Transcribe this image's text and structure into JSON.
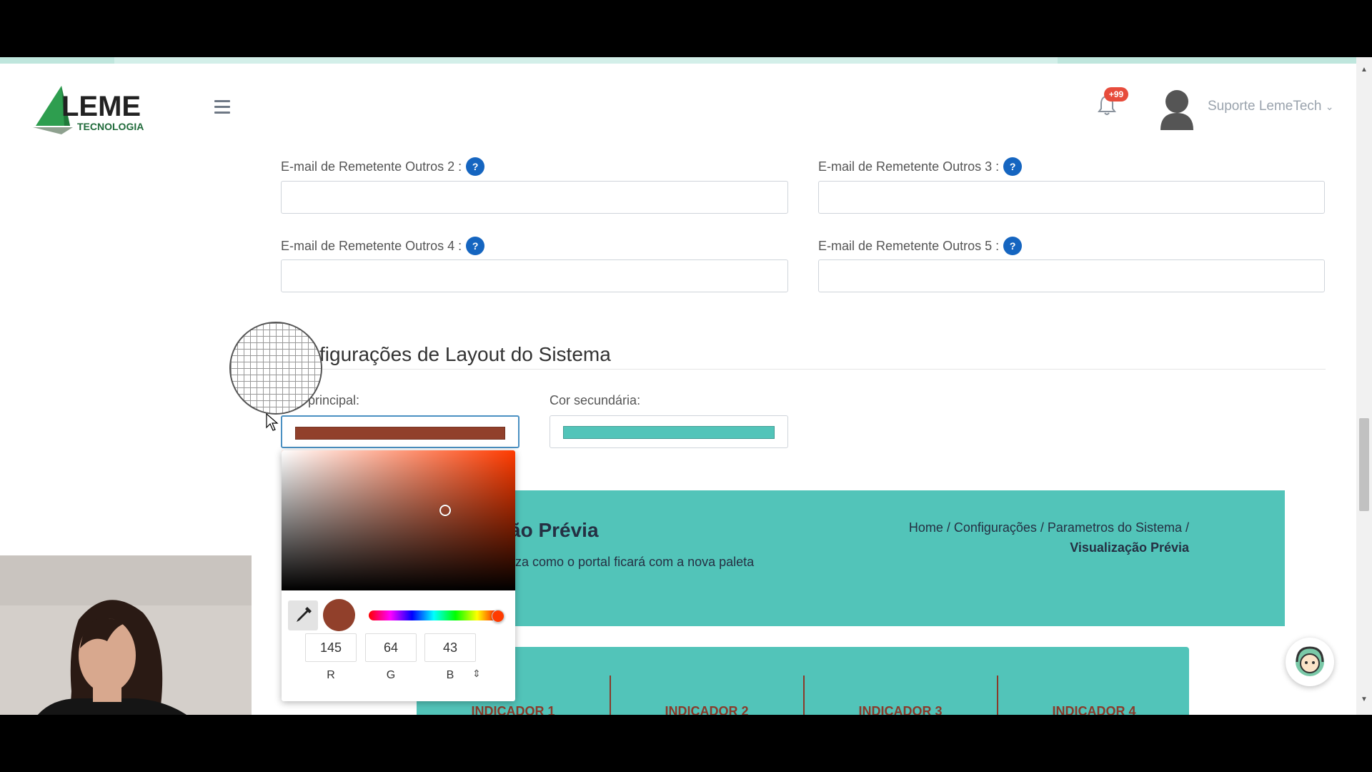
{
  "header": {
    "logo_text": "LEME",
    "logo_subtext": "TECNOLOGIA",
    "notification_badge": "+99",
    "user_name": "Suporte LemeTech"
  },
  "email_fields": [
    {
      "label": "E-mail de Remetente Outros 2 :",
      "value": "",
      "help": "?"
    },
    {
      "label": "E-mail de Remetente Outros 3 :",
      "value": "",
      "help": "?"
    },
    {
      "label": "E-mail de Remetente Outros 4 :",
      "value": "",
      "help": "?"
    },
    {
      "label": "E-mail de Remetente Outros 5 :",
      "value": "",
      "help": "?"
    }
  ],
  "layout_section": {
    "title": "figurações de Layout do Sistema",
    "primary_label": "principal:",
    "secondary_label": "Cor secundária:",
    "primary_color": "#91402b",
    "secondary_color": "#52c4b9"
  },
  "color_picker": {
    "r": "145",
    "g": "64",
    "b": "43",
    "r_label": "R",
    "g_label": "G",
    "b_label": "B",
    "hue_color": "#ff3b00",
    "hue_fraction": 0.99,
    "saturation": 0.7,
    "brightness": 0.57,
    "mode_toggle": "⇕"
  },
  "preview": {
    "title": "ão Prévia",
    "subtitle": "liza como o portal ficará com a nova paleta",
    "breadcrumb_line1": "Home / Configurações / Parametros do Sistema /",
    "breadcrumb_current": "Visualização Prévia",
    "indicators": [
      "INDICADOR 1",
      "INDICADOR 2",
      "INDICADOR 3",
      "INDICADOR 4"
    ],
    "banner_color": "#52c4b9",
    "indicator_text_color": "#8a3a2a"
  }
}
